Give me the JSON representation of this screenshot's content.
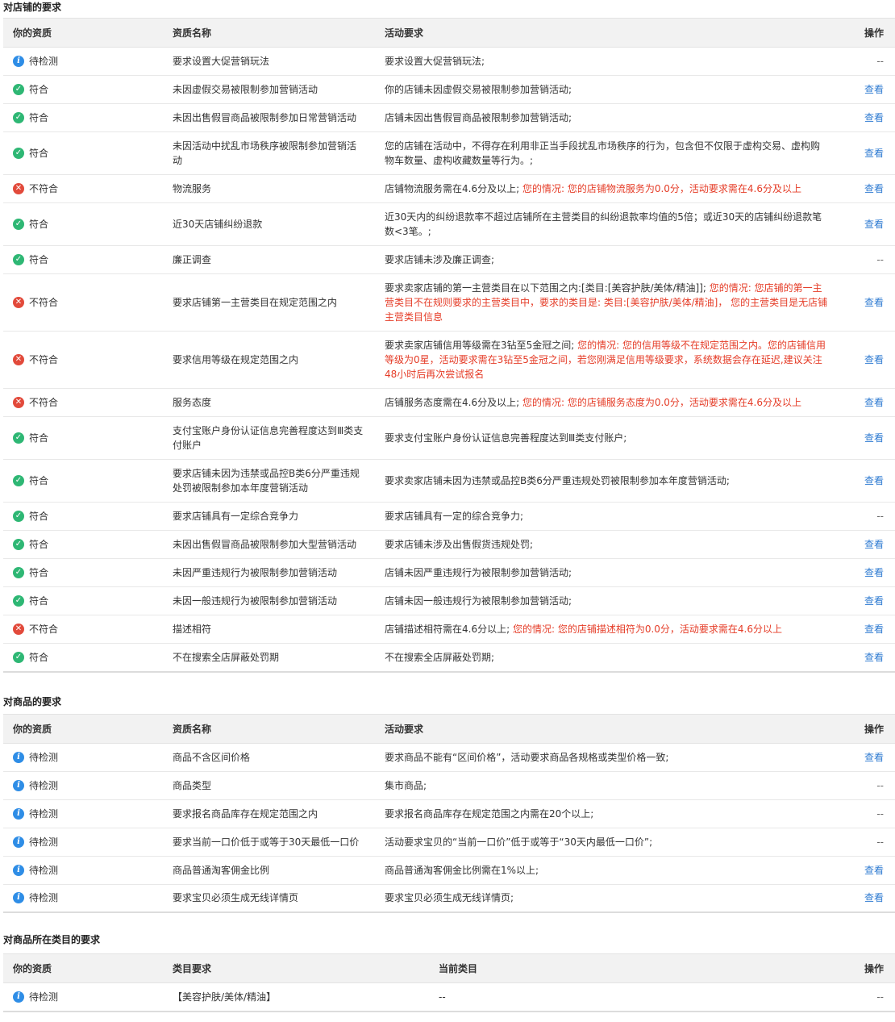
{
  "shop_section": {
    "title": "对店铺的要求",
    "headers": [
      "你的资质",
      "资质名称",
      "活动要求",
      "操作"
    ],
    "rows": [
      {
        "status": "info",
        "status_label": "待检测",
        "name": "要求设置大促营销玩法",
        "req": "要求设置大促营销玩法;",
        "extra": "",
        "action": "--"
      },
      {
        "status": "ok",
        "status_label": "符合",
        "name": "未因虚假交易被限制参加营销活动",
        "req": "你的店铺未因虚假交易被限制参加营销活动;",
        "extra": "",
        "action": "查看"
      },
      {
        "status": "ok",
        "status_label": "符合",
        "name": "未因出售假冒商品被限制参加日常营销活动",
        "req": "店铺未因出售假冒商品被限制参加营销活动;",
        "extra": "",
        "action": "查看"
      },
      {
        "status": "ok",
        "status_label": "符合",
        "name": "未因活动中扰乱市场秩序被限制参加营销活动",
        "req": "您的店铺在活动中，不得存在利用非正当手段扰乱市场秩序的行为，包含但不仅限于虚构交易、虚构购物车数量、虚构收藏数量等行为。;",
        "extra": "",
        "action": "查看"
      },
      {
        "status": "bad",
        "status_label": "不符合",
        "name": "物流服务",
        "req": "店铺物流服务需在4.6分及以上;",
        "extra": "您的情况:  您的店铺物流服务为0.0分，活动要求需在4.6分及以上",
        "action": "查看"
      },
      {
        "status": "ok",
        "status_label": "符合",
        "name": "近30天店铺纠纷退款",
        "req": "近30天内的纠纷退款率不超过店铺所在主营类目的纠纷退款率均值的5倍；或近30天的店铺纠纷退款笔数<3笔。;",
        "extra": "",
        "action": "查看"
      },
      {
        "status": "ok",
        "status_label": "符合",
        "name": "廉正调查",
        "req": "要求店铺未涉及廉正调查;",
        "extra": "",
        "action": "--"
      },
      {
        "status": "bad",
        "status_label": "不符合",
        "name": "要求店铺第一主营类目在规定范围之内",
        "req": "要求卖家店铺的第一主营类目在以下范围之内:[类目:[美容护肤/美体/精油]];",
        "extra": "您的情况:  您店铺的第一主营类目不在规则要求的主营类目中，要求的类目是: 类目:[美容护肤/美体/精油]，  您的主营类目是无店铺主营类目信息",
        "action": "查看"
      },
      {
        "status": "bad",
        "status_label": "不符合",
        "name": "要求信用等级在规定范围之内",
        "req": "要求卖家店铺信用等级需在3钻至5金冠之间;",
        "extra": "您的情况:  您的信用等级不在规定范围之内。您的店铺信用等级为0星，活动要求需在3钻至5金冠之间，若您刚满足信用等级要求，系统数据会存在延迟,建议关注48小时后再次尝试报名",
        "action": "查看"
      },
      {
        "status": "bad",
        "status_label": "不符合",
        "name": "服务态度",
        "req": "店铺服务态度需在4.6分及以上;",
        "extra": "您的情况:  您的店铺服务态度为0.0分，活动要求需在4.6分及以上",
        "action": "查看"
      },
      {
        "status": "ok",
        "status_label": "符合",
        "name": "支付宝账户身份认证信息完善程度达到Ⅲ类支付账户",
        "req": "要求支付宝账户身份认证信息完善程度达到Ⅲ类支付账户;",
        "extra": "",
        "action": "查看"
      },
      {
        "status": "ok",
        "status_label": "符合",
        "name": "要求店铺未因为违禁或品控B类6分严重违规处罚被限制参加本年度营销活动",
        "req": "要求卖家店铺未因为违禁或品控B类6分严重违规处罚被限制参加本年度营销活动;",
        "extra": "",
        "action": "查看"
      },
      {
        "status": "ok",
        "status_label": "符合",
        "name": "要求店铺具有一定综合竞争力",
        "req": "要求店铺具有一定的综合竞争力;",
        "extra": "",
        "action": "--"
      },
      {
        "status": "ok",
        "status_label": "符合",
        "name": "未因出售假冒商品被限制参加大型营销活动",
        "req": "要求店铺未涉及出售假货违规处罚;",
        "extra": "",
        "action": "查看"
      },
      {
        "status": "ok",
        "status_label": "符合",
        "name": "未因严重违规行为被限制参加营销活动",
        "req": "店铺未因严重违规行为被限制参加营销活动;",
        "extra": "",
        "action": "查看"
      },
      {
        "status": "ok",
        "status_label": "符合",
        "name": "未因一般违规行为被限制参加营销活动",
        "req": "店铺未因一般违规行为被限制参加营销活动;",
        "extra": "",
        "action": "查看"
      },
      {
        "status": "bad",
        "status_label": "不符合",
        "name": "描述相符",
        "req": "店铺描述相符需在4.6分以上;",
        "extra": "您的情况:  您的店铺描述相符为0.0分，活动要求需在4.6分以上",
        "action": "查看"
      },
      {
        "status": "ok",
        "status_label": "符合",
        "name": "不在搜索全店屏蔽处罚期",
        "req": "不在搜索全店屏蔽处罚期;",
        "extra": "",
        "action": "查看"
      }
    ]
  },
  "goods_section": {
    "title": "对商品的要求",
    "headers": [
      "你的资质",
      "资质名称",
      "活动要求",
      "操作"
    ],
    "rows": [
      {
        "status": "info",
        "status_label": "待检测",
        "name": "商品不含区间价格",
        "req": "要求商品不能有“区间价格”，活动要求商品各规格或类型价格一致;",
        "extra": "",
        "action": "查看"
      },
      {
        "status": "info",
        "status_label": "待检测",
        "name": "商品类型",
        "req": "集市商品;",
        "extra": "",
        "action": "--"
      },
      {
        "status": "info",
        "status_label": "待检测",
        "name": "要求报名商品库存在规定范围之内",
        "req": "要求报名商品库存在规定范围之内需在20个以上;",
        "extra": "",
        "action": "--"
      },
      {
        "status": "info",
        "status_label": "待检测",
        "name": "要求当前一口价低于或等于30天最低一口价",
        "req": "活动要求宝贝的“当前一口价”低于或等于“30天内最低一口价”;",
        "extra": "",
        "action": "--"
      },
      {
        "status": "info",
        "status_label": "待检测",
        "name": "商品普通淘客佣金比例",
        "req": "商品普通淘客佣金比例需在1%以上;",
        "extra": "",
        "action": "查看"
      },
      {
        "status": "info",
        "status_label": "待检测",
        "name": "要求宝贝必须生成无线详情页",
        "req": "要求宝贝必须生成无线详情页;",
        "extra": "",
        "action": "查看"
      }
    ]
  },
  "category_section": {
    "title": "对商品所在类目的要求",
    "headers": [
      "你的资质",
      "类目要求",
      "当前类目",
      "操作"
    ],
    "rows": [
      {
        "status": "info",
        "status_label": "待检测",
        "name": "【美容护肤/美体/精油】",
        "req": "--",
        "extra": "",
        "action": "--"
      }
    ]
  },
  "icons": {
    "ok": "check-circle-icon",
    "bad": "x-circle-icon",
    "info": "info-circle-icon"
  },
  "colors": {
    "ok": "#2eb774",
    "bad": "#e24a3b",
    "info": "#2e8de6",
    "link": "#2f7bd2",
    "warning_text": "#e53c27"
  }
}
